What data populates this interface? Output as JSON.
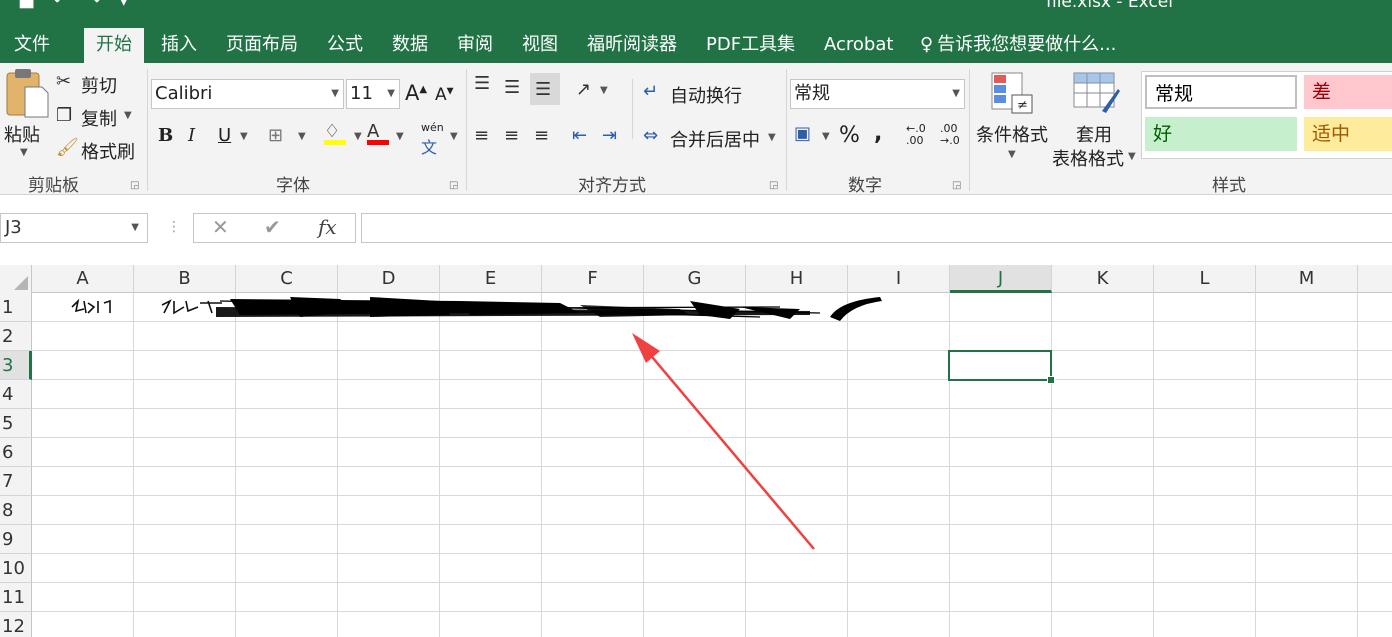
{
  "window": {
    "title": "file.xlsx  -  Excel",
    "qat_icons": [
      "save-icon",
      "undo-icon",
      "redo-icon",
      "customize-icon"
    ]
  },
  "tabs": [
    {
      "label": "文件",
      "active": false
    },
    {
      "label": "开始",
      "active": true
    },
    {
      "label": "插入",
      "active": false
    },
    {
      "label": "页面布局",
      "active": false
    },
    {
      "label": "公式",
      "active": false
    },
    {
      "label": "数据",
      "active": false
    },
    {
      "label": "审阅",
      "active": false
    },
    {
      "label": "视图",
      "active": false
    },
    {
      "label": "福昕阅读器",
      "active": false
    },
    {
      "label": "PDF工具集",
      "active": false
    },
    {
      "label": "Acrobat",
      "active": false
    }
  ],
  "tell_me": "告诉我您想要做什么...",
  "ribbon": {
    "clipboard": {
      "paste": "粘贴",
      "cut": "剪切",
      "copy": "复制",
      "format_painter": "格式刷",
      "label": "剪贴板"
    },
    "font": {
      "name": "Calibri",
      "size": "11",
      "bold": "B",
      "italic": "I",
      "underline": "U",
      "label": "字体",
      "fill_color": "#ffff00",
      "font_color": "#ff0000",
      "phonetic": "wén"
    },
    "alignment": {
      "wrap_text": "自动换行",
      "merge_center": "合并后居中",
      "label": "对齐方式"
    },
    "number": {
      "format": "常规",
      "percent": "%",
      "comma": ",",
      "label": "数字"
    },
    "styles": {
      "conditional_format": "条件格式",
      "table_format_line1": "套用",
      "table_format_line2": "表格格式",
      "cells": [
        {
          "label": "常规",
          "bg": "#ffffff",
          "color": "#000000"
        },
        {
          "label": "差",
          "bg": "#ffc7ce",
          "color": "#9c0006"
        },
        {
          "label": "好",
          "bg": "#c6efce",
          "color": "#006100"
        },
        {
          "label": "适中",
          "bg": "#ffeb9c",
          "color": "#9c5700"
        }
      ],
      "label": "样式"
    }
  },
  "formula_bar": {
    "name_box": "J3",
    "cancel": "✕",
    "enter": "✔",
    "fx": "fx",
    "value": ""
  },
  "sheet": {
    "columns": [
      "A",
      "B",
      "C",
      "D",
      "E",
      "F",
      "G",
      "H",
      "I",
      "J",
      "K",
      "L",
      "M"
    ],
    "rows": [
      "1",
      "2",
      "3",
      "4",
      "5",
      "6",
      "7",
      "8",
      "9",
      "10",
      "11",
      "12"
    ],
    "selected_cell": "J3",
    "selected_column": "J",
    "selected_row": "3"
  },
  "annotation": {
    "arrow_color": "#f04040"
  }
}
